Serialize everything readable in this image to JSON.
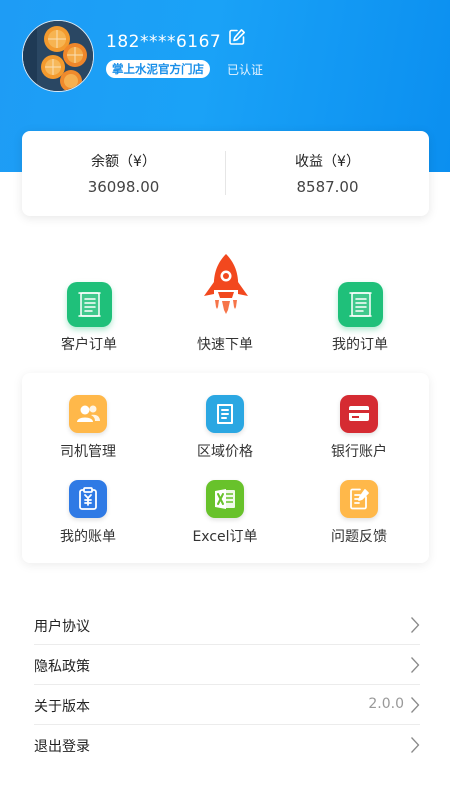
{
  "header": {
    "phone": "182****6167",
    "store_name": "掌上水泥官方门店",
    "verified": "已认证"
  },
  "balance": {
    "balance_label": "余额（¥）",
    "balance_value": "36098.00",
    "income_label": "收益（¥）",
    "income_value": "8587.00"
  },
  "quick_actions": [
    {
      "label": "客户订单",
      "icon": "document-icon"
    },
    {
      "label": "快速下单",
      "icon": "rocket-icon"
    },
    {
      "label": "我的订单",
      "icon": "document-icon"
    }
  ],
  "grid": [
    {
      "label": "司机管理",
      "icon": "users-icon",
      "color": "#ffb84a"
    },
    {
      "label": "区域价格",
      "icon": "book-icon",
      "color": "#2ba7e2"
    },
    {
      "label": "银行账户",
      "icon": "bank-card-icon",
      "color": "#d52b32"
    },
    {
      "label": "我的账单",
      "icon": "bill-icon",
      "color": "#2f7ae5"
    },
    {
      "label": "Excel订单",
      "icon": "excel-icon",
      "color": "#68c22b"
    },
    {
      "label": "问题反馈",
      "icon": "feedback-icon",
      "color": "#ffb84a"
    }
  ],
  "menu": [
    {
      "label": "用户协议"
    },
    {
      "label": "隐私政策"
    },
    {
      "label": "关于版本",
      "value": "2.0.0"
    },
    {
      "label": "退出登录"
    }
  ],
  "colors": {
    "header_blue": "#1e9cf5",
    "green": "#1fc07a",
    "rocket": "#f2481e"
  }
}
